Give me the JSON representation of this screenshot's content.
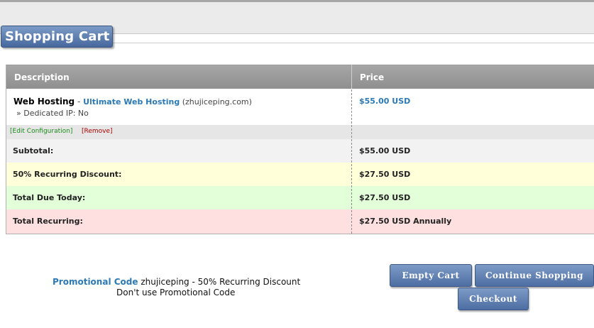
{
  "page": {
    "title": "Shopping Cart"
  },
  "table": {
    "headers": {
      "description": "Description",
      "price": "Price"
    },
    "item": {
      "product": "Web Hosting",
      "separator": " - ",
      "plan": "Ultimate Web Hosting",
      "domain": " (zhujiceping.com)",
      "option": "» Dedicated IP: No",
      "price": "$55.00 USD",
      "edit_label": "[Edit Configuration]",
      "remove_label": "[Remove]"
    },
    "summary": [
      {
        "label": "Subtotal:",
        "value": "$55.00 USD"
      },
      {
        "label": "50% Recurring Discount:",
        "value": "$27.50 USD"
      },
      {
        "label": "Total Due Today:",
        "value": "$27.50 USD"
      },
      {
        "label": "Total Recurring:",
        "value": "$27.50 USD Annually"
      }
    ]
  },
  "promo": {
    "label": "Promotional Code",
    "text": " zhujiceping - 50% Recurring Discount",
    "remove_label": "Don't use Promotional Code"
  },
  "buttons": {
    "empty_cart": "Empty Cart",
    "continue_shopping": "Continue Shopping",
    "checkout": "Checkout"
  },
  "colors": {
    "accent": "#2b79b5",
    "button": "#5a78aa",
    "discount_row": "#ffffd9",
    "today_row": "#e3ffd9",
    "recurring_row": "#ffe0e0"
  }
}
